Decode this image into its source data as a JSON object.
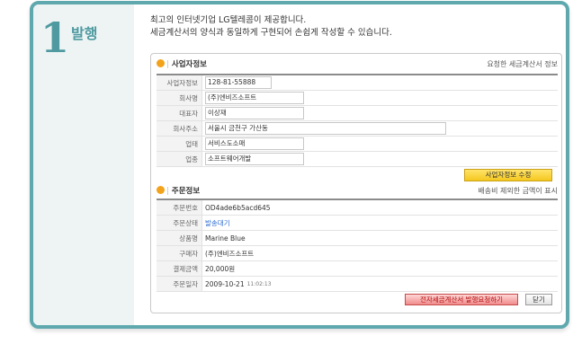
{
  "step": {
    "number": "1",
    "title": "발행"
  },
  "intro": {
    "line1": "최고의 인터넷기업 LG텔레콤이 제공합니다.",
    "line2": "세금계산서의 양식과 동일하게 구현되어 손쉽게 작성할 수 있습니다."
  },
  "business": {
    "title": "사업자정보",
    "note": "요청한 세금계산서 정보",
    "rows": [
      {
        "label": "사업자정보",
        "value": "128-81-55888"
      },
      {
        "label": "회사명",
        "value": "(주)엔비즈소프트"
      },
      {
        "label": "대표자",
        "value": "이상재"
      },
      {
        "label": "회사주소",
        "value": "서울시 금천구 가산동"
      },
      {
        "label": "업태",
        "value": "서비스도소매"
      },
      {
        "label": "업종",
        "value": "소프트웨어개발"
      }
    ],
    "edit_button": "사업자정보 수정"
  },
  "order": {
    "title": "주문정보",
    "note": "배송비 제외한 금액이 표시",
    "rows": [
      {
        "label": "주문번호",
        "value": "OD4ade6b5acd645"
      },
      {
        "label": "주문상태",
        "value": "발송대기"
      },
      {
        "label": "상품명",
        "value": "Marine Blue"
      },
      {
        "label": "구매자",
        "value": "(주)엔비즈소프트"
      },
      {
        "label": "결제금액",
        "value": "20,000원"
      },
      {
        "label": "주문일자",
        "value": "2009-10-21",
        "time": "11:02:13"
      }
    ],
    "request_button": "전자세금계산서 발행요청하기",
    "close_button": "닫기"
  }
}
